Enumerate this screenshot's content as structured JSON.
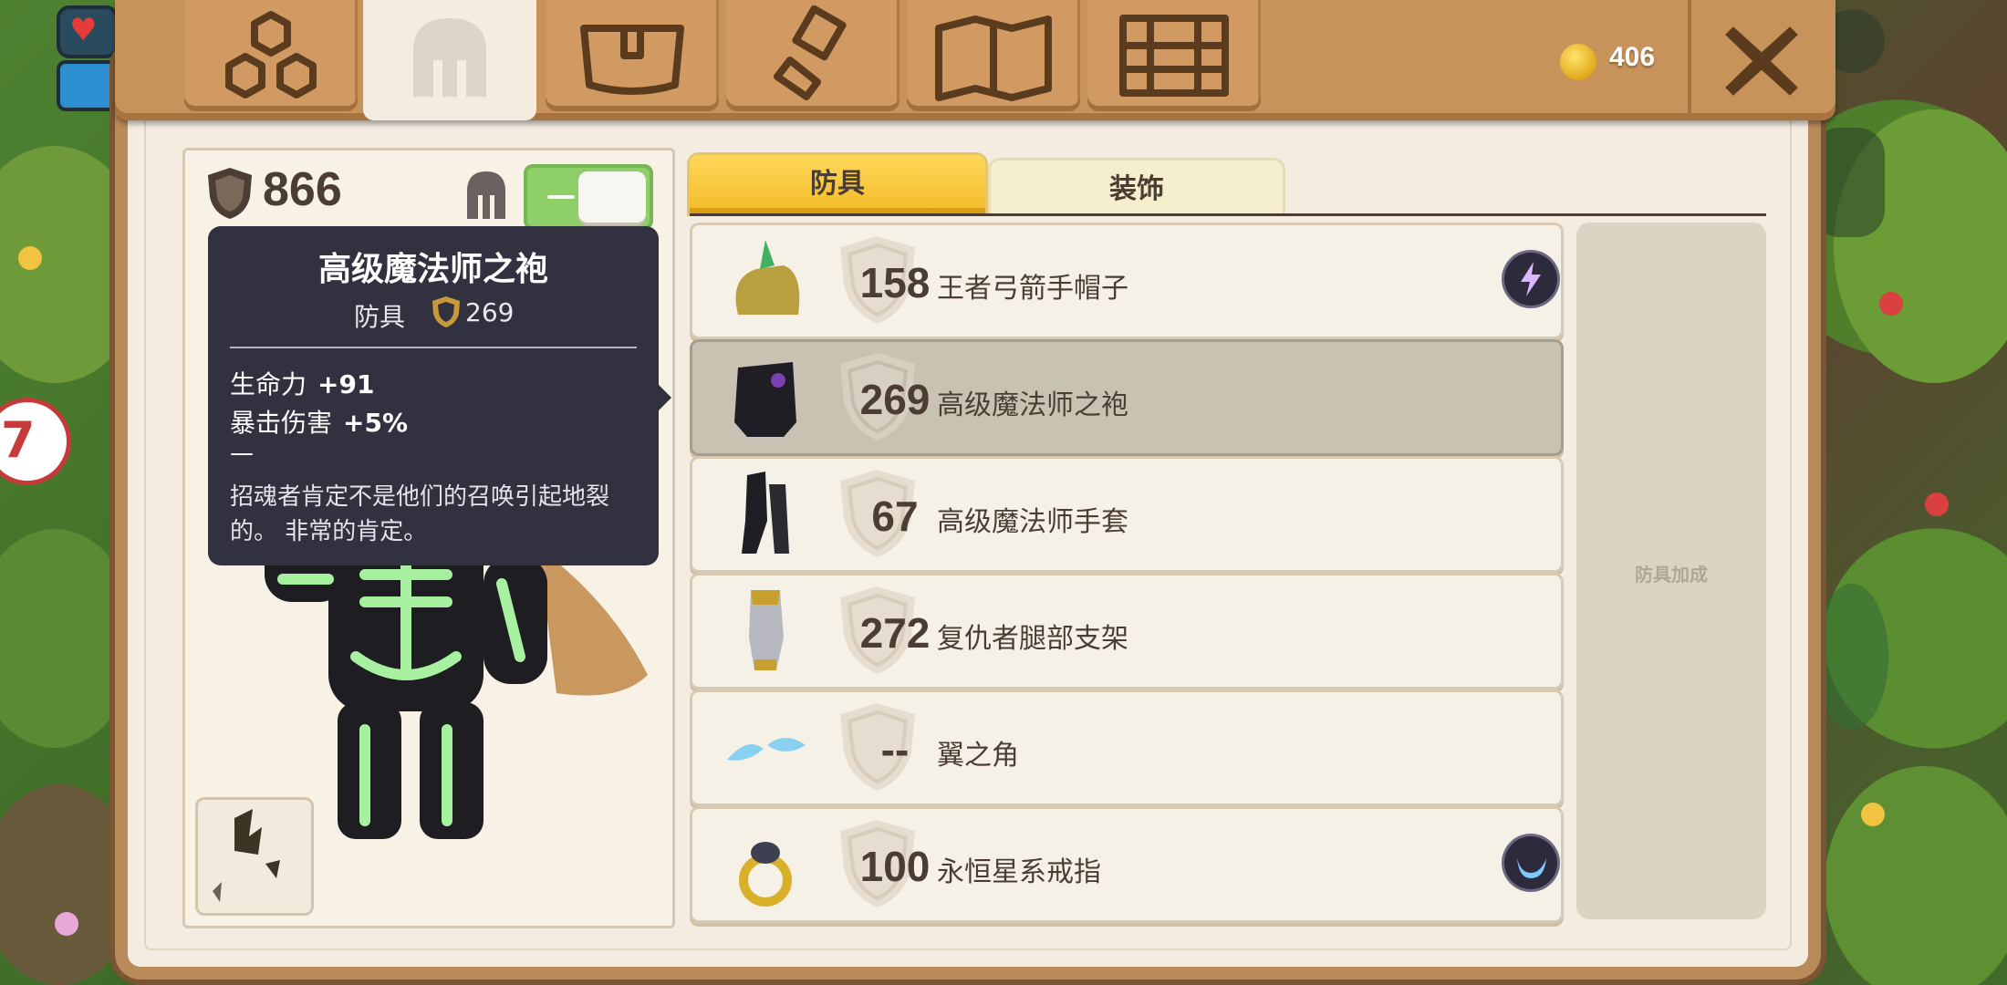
{
  "top_bar": {
    "tabs": [
      {
        "icon": "hierarchy-icon"
      },
      {
        "icon": "helmet-icon",
        "active": true
      },
      {
        "icon": "satchel-icon"
      },
      {
        "icon": "hammer-icon"
      },
      {
        "icon": "map-icon"
      },
      {
        "icon": "chest-icon"
      }
    ],
    "coins": "406",
    "close_icon": "close-icon"
  },
  "character": {
    "armor_total": "866",
    "toggle_on": true
  },
  "tooltip": {
    "title": "高级魔法师之袍",
    "type": "防具",
    "armor": "269",
    "stats": [
      {
        "label": "生命力",
        "value": "+91"
      },
      {
        "label": "暴击伤害",
        "value": "+5%"
      }
    ],
    "divider": "—",
    "description": "招魂者肯定不是他们的召唤引起地裂的。 非常的肯定。"
  },
  "tabs": {
    "armor": "防具",
    "decoration": "装饰"
  },
  "items": [
    {
      "armor": "158",
      "name": "王者弓箭手帽子",
      "rune": "lightning-icon"
    },
    {
      "armor": "269",
      "name": "高级魔法师之袍",
      "selected": true
    },
    {
      "armor": "67",
      "name": "高级魔法师手套"
    },
    {
      "armor": "272",
      "name": "复仇者腿部支架"
    },
    {
      "armor": "--",
      "name": "翼之角"
    },
    {
      "armor": "100",
      "name": "永恒星系戒指",
      "rune": "moon-icon"
    }
  ],
  "bonus_panel": {
    "label": "防具加成"
  },
  "colors": {
    "wood": "#c8935a",
    "panel": "#f4ece0",
    "active_tab": "#f2bb28",
    "tooltip_bg": "#31313f",
    "toggle_green": "#8fcf6a"
  }
}
